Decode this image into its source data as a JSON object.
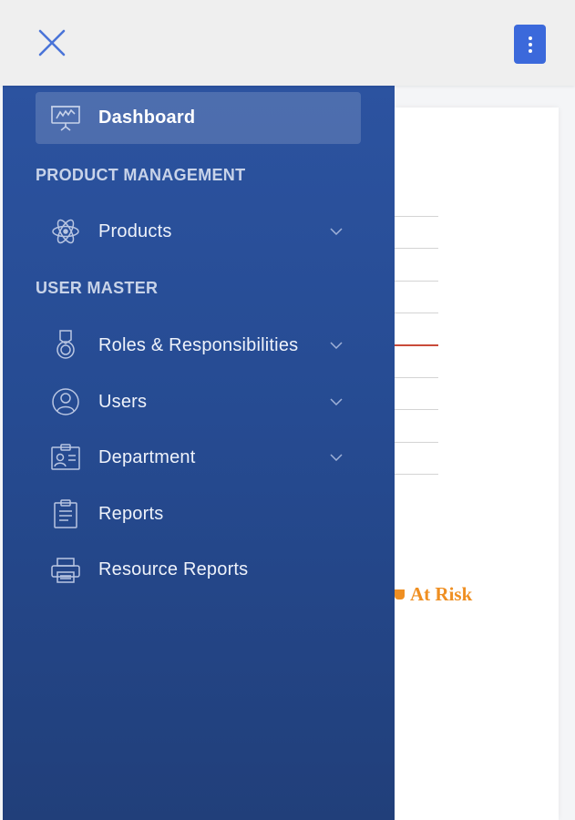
{
  "topbar": {
    "close_icon": "close-icon",
    "menu_icon": "more-vertical-icon",
    "menu_button_color": "#3b69db"
  },
  "sidebar": {
    "active_item": {
      "label": "Dashboard",
      "icon": "presentation-chart-icon"
    },
    "sections": [
      {
        "title": "PRODUCT MANAGEMENT",
        "items": [
          {
            "label": "Products",
            "icon": "atom-icon",
            "expandable": true
          }
        ]
      },
      {
        "title": "USER MASTER",
        "items": [
          {
            "label": "Roles & Responsibilities",
            "icon": "medal-icon",
            "expandable": true
          },
          {
            "label": "Users",
            "icon": "user-circle-icon",
            "expandable": true
          },
          {
            "label": "Department",
            "icon": "id-card-icon",
            "expandable": true
          },
          {
            "label": "Reports",
            "icon": "clipboard-icon",
            "expandable": false
          },
          {
            "label": "Resource Reports",
            "icon": "printer-icon",
            "expandable": false
          }
        ]
      }
    ]
  },
  "background": {
    "legend_label": "At Risk",
    "legend_color": "#ef8f22"
  }
}
